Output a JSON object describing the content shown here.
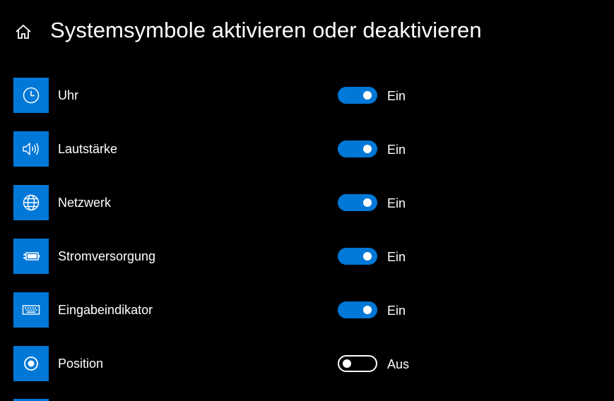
{
  "header": {
    "title": "Systemsymbole aktivieren oder deaktivieren",
    "home_icon": "home-icon"
  },
  "colors": {
    "background": "#000000",
    "accent": "#0078d7",
    "text": "#ffffff"
  },
  "items": [
    {
      "label": "Uhr",
      "icon": "clock-icon",
      "on": true,
      "state": "Ein"
    },
    {
      "label": "Lautstärke",
      "icon": "volume-icon",
      "on": true,
      "state": "Ein"
    },
    {
      "label": "Netzwerk",
      "icon": "globe-icon",
      "on": true,
      "state": "Ein"
    },
    {
      "label": "Stromversorgung",
      "icon": "battery-icon",
      "on": true,
      "state": "Ein"
    },
    {
      "label": "Eingabeindikator",
      "icon": "keyboard-icon",
      "on": true,
      "state": "Ein"
    },
    {
      "label": "Position",
      "icon": "location-icon",
      "on": false,
      "state": "Aus"
    }
  ]
}
